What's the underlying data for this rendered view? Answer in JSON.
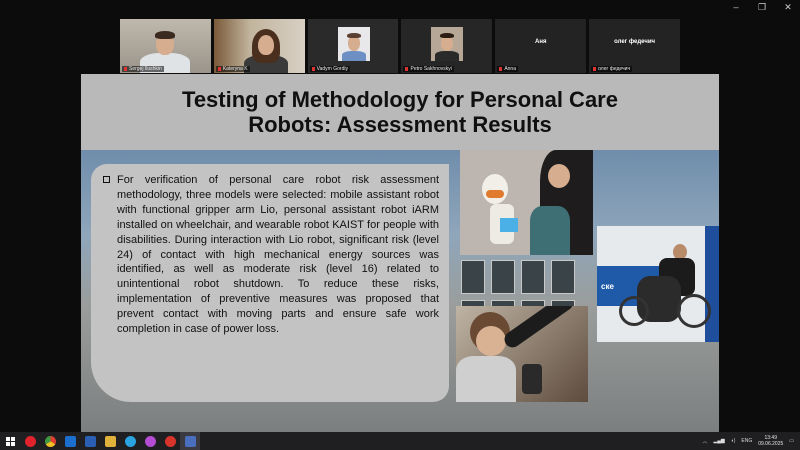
{
  "window": {
    "controls": {
      "minimize": "–",
      "restore": "❐",
      "close": "✕"
    }
  },
  "participants": [
    {
      "name": "Sergej Ilushkin",
      "active": false,
      "video": true
    },
    {
      "name": "Kateryna K",
      "active": false,
      "video": true
    },
    {
      "name": "Vadym Gordiy",
      "active": false,
      "video": true
    },
    {
      "name": "Petro Sakhnovskyi",
      "active": true,
      "video": true
    },
    {
      "name": "Anna",
      "label": "Аня",
      "active": false,
      "video": false
    },
    {
      "name": "олег федечич",
      "label": "олег федечич",
      "active": false,
      "video": false
    }
  ],
  "slide": {
    "title": "Testing of Methodology for Personal Care Robots: Assessment Results",
    "body": "For verification of personal care robot risk assessment methodology, three models were selected: mobile assistant robot with functional gripper arm Lio, personal assistant robot iARM installed on wheelchair, and wearable robot KAIST for people with disabilities. During interaction with Lio robot, significant risk (level 24) of contact with high mechanical energy sources was identified, as well as moderate risk (level 16) related to unintentional robot shutdown. To reduce these risks, implementation of preventive measures was proposed that prevent contact with moving parts and ensure safe work completion in case of power loss.",
    "photo_caption_logo": "ске"
  },
  "taskbar": {
    "apps": [
      {
        "icon": "opera-icon",
        "color": "#e2232e"
      },
      {
        "icon": "chrome-icon",
        "color": "#3f9a3f"
      },
      {
        "icon": "outlook-icon",
        "color": "#1a6fcf"
      },
      {
        "icon": "word-icon",
        "color": "#2b5fb4"
      },
      {
        "icon": "explorer-icon",
        "color": "#e0b23c"
      },
      {
        "icon": "telegram-icon",
        "color": "#2aa3e0"
      },
      {
        "icon": "app-icon",
        "color": "#b44cd4"
      },
      {
        "icon": "yandex-icon",
        "color": "#d9342b"
      },
      {
        "icon": "meeting-icon",
        "color": "#4a6fbf"
      }
    ],
    "tray": {
      "lang": "ENG",
      "time": "13:49",
      "date": "09.06.2025"
    }
  }
}
